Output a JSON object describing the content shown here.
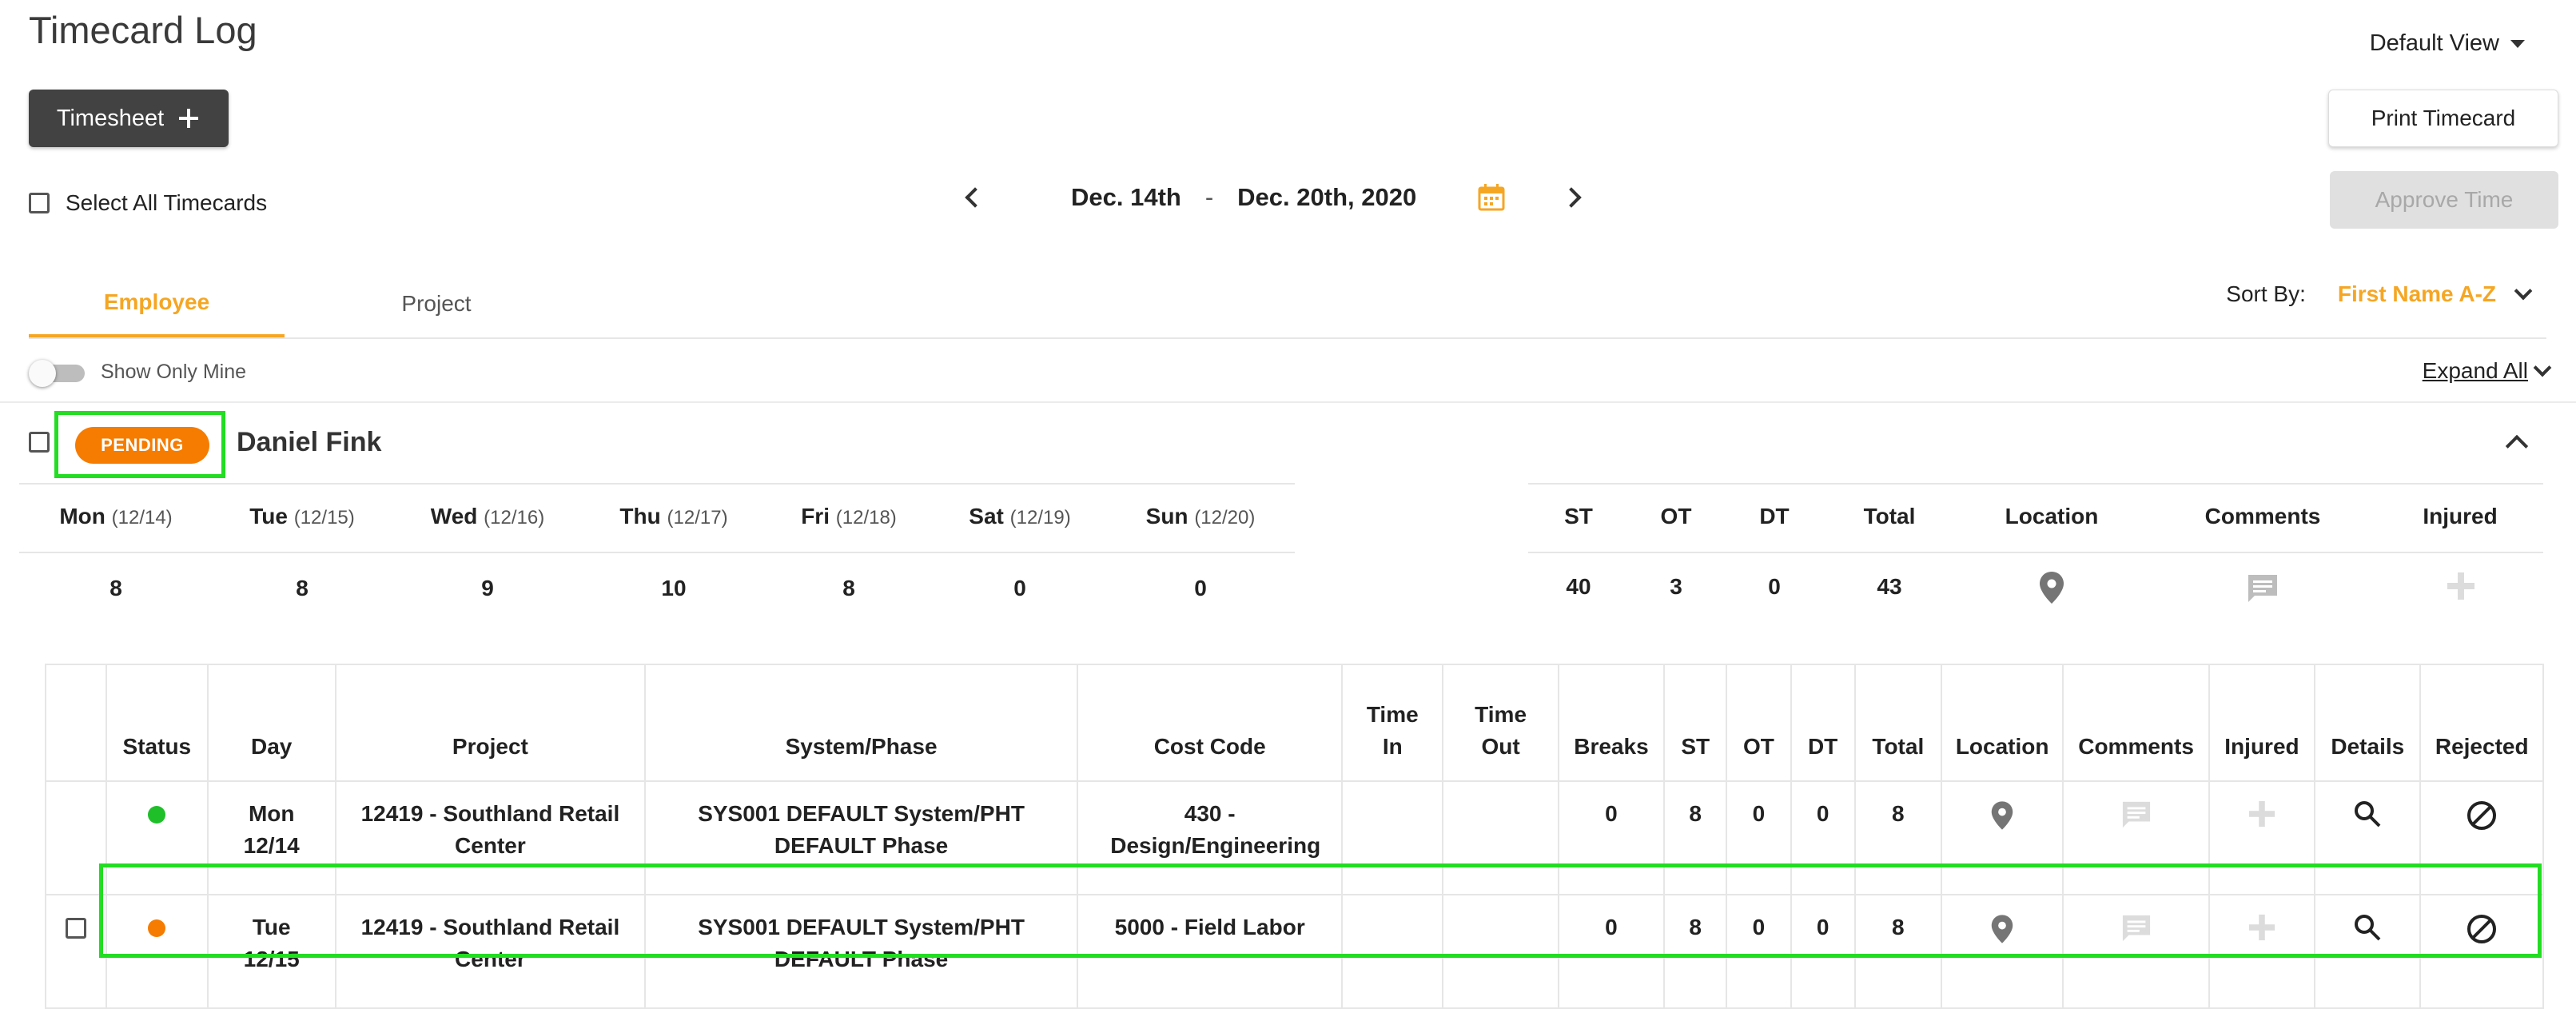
{
  "page": {
    "title": "Timecard Log",
    "default_view": "Default View"
  },
  "toolbar": {
    "timesheet_label": "Timesheet",
    "print_label": "Print Timecard",
    "approve_label": "Approve Time",
    "select_all_label": "Select All Timecards"
  },
  "date_range": {
    "start": "Dec. 14th",
    "separator": "-",
    "end": "Dec. 20th, 2020"
  },
  "tabs": {
    "employee": "Employee",
    "project": "Project"
  },
  "sort": {
    "label": "Sort By:",
    "value": "First Name A-Z"
  },
  "filters": {
    "show_only_mine": "Show Only Mine",
    "expand_all": "Expand All"
  },
  "employee": {
    "status": "PENDING",
    "name": "Daniel Fink",
    "days": [
      {
        "day": "Mon",
        "date": "(12/14)",
        "hours": "8"
      },
      {
        "day": "Tue",
        "date": "(12/15)",
        "hours": "8"
      },
      {
        "day": "Wed",
        "date": "(12/16)",
        "hours": "9"
      },
      {
        "day": "Thu",
        "date": "(12/17)",
        "hours": "10"
      },
      {
        "day": "Fri",
        "date": "(12/18)",
        "hours": "8"
      },
      {
        "day": "Sat",
        "date": "(12/19)",
        "hours": "0"
      },
      {
        "day": "Sun",
        "date": "(12/20)",
        "hours": "0"
      }
    ],
    "summary_headers": [
      "ST",
      "OT",
      "DT",
      "Total",
      "Location",
      "Comments",
      "Injured"
    ],
    "summary_values": {
      "st": "40",
      "ot": "3",
      "dt": "0",
      "total": "43"
    }
  },
  "detail_table": {
    "headers": [
      "Status",
      "Day",
      "Project",
      "System/Phase",
      "Cost Code",
      "Time In",
      "Time Out",
      "Breaks",
      "ST",
      "OT",
      "DT",
      "Total",
      "Location",
      "Comments",
      "Injured",
      "Details",
      "Rejected"
    ],
    "rows": [
      {
        "status_color": "#1fbf2a",
        "day": "Mon 12/14",
        "project": "12419 - Southland Retail Center",
        "system_phase": "SYS001 DEFAULT System/PHT DEFAULT Phase",
        "cost_code": "430 - Design/Engineering",
        "time_in": "",
        "time_out": "",
        "breaks": "0",
        "st": "8",
        "ot": "0",
        "dt": "0",
        "total": "8"
      },
      {
        "status_color": "#f57c00",
        "day": "Tue 12/15",
        "project": "12419 - Southland Retail Center",
        "system_phase": "SYS001 DEFAULT System/PHT DEFAULT Phase",
        "cost_code": "5000 - Field Labor",
        "time_in": "",
        "time_out": "",
        "breaks": "0",
        "st": "8",
        "ot": "0",
        "dt": "0",
        "total": "8"
      }
    ]
  },
  "colors": {
    "accent": "#f5a623",
    "pending": "#f57c00",
    "approved_dot": "#1fbf2a",
    "highlight": "#22dd22"
  }
}
